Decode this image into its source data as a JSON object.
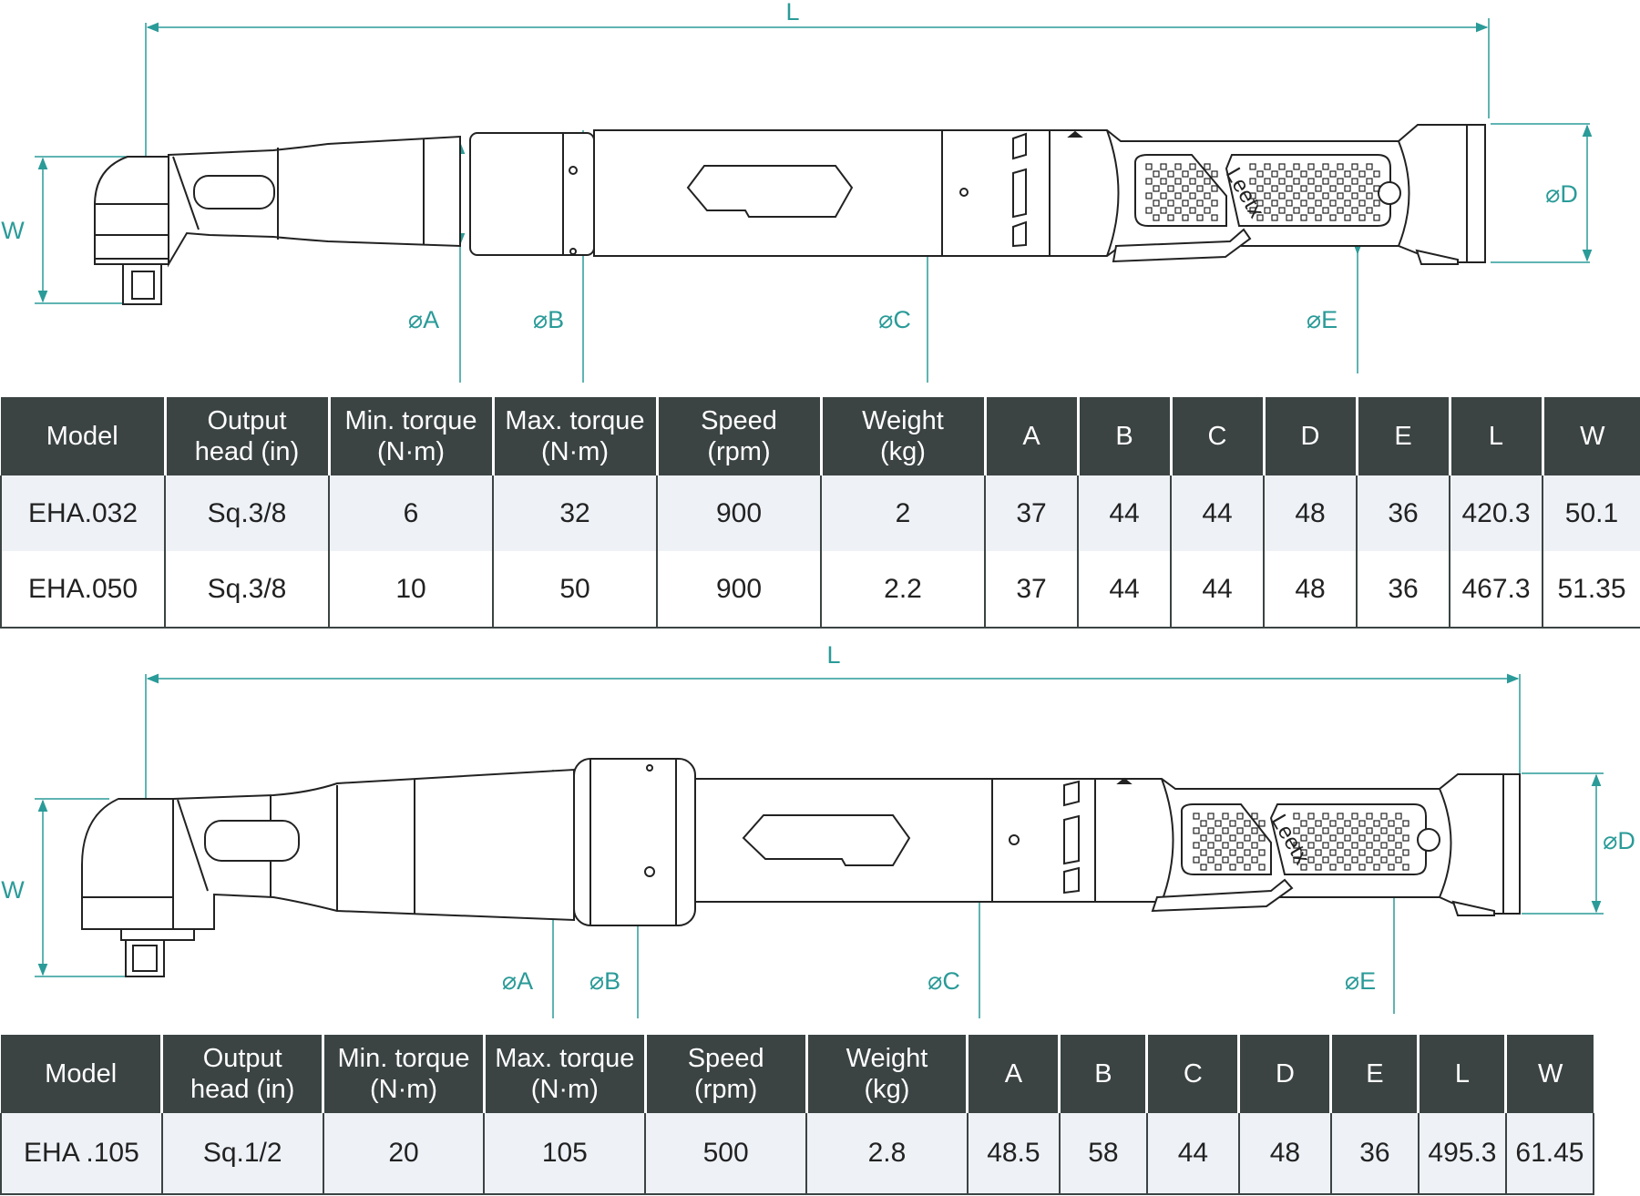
{
  "diagram_top": {
    "dimension_labels": {
      "L": "L",
      "W": "W",
      "A": "⌀A",
      "B": "⌀B",
      "C": "⌀C",
      "D": "⌀D",
      "E": "⌀E"
    },
    "brand_mark": "Leetx"
  },
  "table_top": {
    "headers": [
      {
        "line1": "Model",
        "line2": ""
      },
      {
        "line1": "Output",
        "line2": "head (in)"
      },
      {
        "line1": "Min. torque",
        "line2": "(N·m)"
      },
      {
        "line1": "Max. torque",
        "line2": "(N·m)"
      },
      {
        "line1": "Speed",
        "line2": "(rpm)"
      },
      {
        "line1": "Weight",
        "line2": "(kg)"
      },
      {
        "line1": "A",
        "line2": ""
      },
      {
        "line1": "B",
        "line2": ""
      },
      {
        "line1": "C",
        "line2": ""
      },
      {
        "line1": "D",
        "line2": ""
      },
      {
        "line1": "E",
        "line2": ""
      },
      {
        "line1": "L",
        "line2": ""
      },
      {
        "line1": "W",
        "line2": ""
      }
    ],
    "rows": [
      [
        "EHA.032",
        "Sq.3/8",
        "6",
        "32",
        "900",
        "2",
        "37",
        "44",
        "44",
        "48",
        "36",
        "420.3",
        "50.1"
      ],
      [
        "EHA.050",
        "Sq.3/8",
        "10",
        "50",
        "900",
        "2.2",
        "37",
        "44",
        "44",
        "48",
        "36",
        "467.3",
        "51.35"
      ]
    ]
  },
  "diagram_bottom": {
    "dimension_labels": {
      "L": "L",
      "W": "W",
      "A": "⌀A",
      "B": "⌀B",
      "C": "⌀C",
      "D": "⌀D",
      "E": "⌀E"
    },
    "brand_mark": "Leetx"
  },
  "table_bottom": {
    "headers": [
      {
        "line1": "Model",
        "line2": ""
      },
      {
        "line1": "Output",
        "line2": "head (in)"
      },
      {
        "line1": "Min. torque",
        "line2": "(N·m)"
      },
      {
        "line1": "Max. torque",
        "line2": "(N·m)"
      },
      {
        "line1": "Speed",
        "line2": "(rpm)"
      },
      {
        "line1": "Weight",
        "line2": "(kg)"
      },
      {
        "line1": "A",
        "line2": ""
      },
      {
        "line1": "B",
        "line2": ""
      },
      {
        "line1": "C",
        "line2": ""
      },
      {
        "line1": "D",
        "line2": ""
      },
      {
        "line1": "E",
        "line2": ""
      },
      {
        "line1": "L",
        "line2": ""
      },
      {
        "line1": "W",
        "line2": ""
      }
    ],
    "rows": [
      [
        "EHA .105",
        "Sq.1/2",
        "20",
        "105",
        "500",
        "2.8",
        "48.5",
        "58",
        "44",
        "48",
        "36",
        "495.3",
        "61.45"
      ]
    ]
  },
  "colors": {
    "dimension": "#2a9b98",
    "outline": "#222222",
    "header_bg": "#3b4343",
    "row_tint": "#eef2f7"
  }
}
